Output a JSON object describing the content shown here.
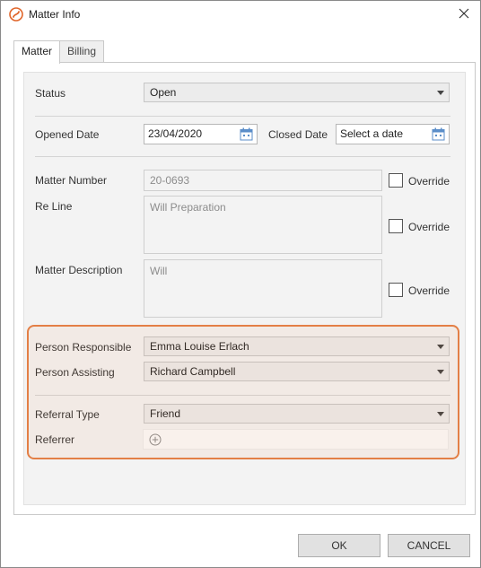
{
  "window": {
    "title": "Matter Info",
    "app_icon": "app-logo-icon",
    "close_icon": "close-icon"
  },
  "tabs": [
    {
      "label": "Matter",
      "active": true
    },
    {
      "label": "Billing",
      "active": false
    }
  ],
  "form": {
    "status": {
      "label": "Status",
      "value": "Open"
    },
    "opened_date": {
      "label": "Opened Date",
      "value": "23/04/2020"
    },
    "closed_date": {
      "label": "Closed Date",
      "placeholder": "Select a date"
    },
    "matter_number": {
      "label": "Matter Number",
      "value": "20-0693",
      "override_label": "Override"
    },
    "re_line": {
      "label": "Re Line",
      "value": "Will Preparation",
      "override_label": "Override"
    },
    "matter_description": {
      "label": "Matter Description",
      "value": "Will",
      "override_label": "Override"
    },
    "person_responsible": {
      "label": "Person Responsible",
      "value": "Emma Louise Erlach"
    },
    "person_assisting": {
      "label": "Person Assisting",
      "value": "Richard Campbell"
    },
    "referral_type": {
      "label": "Referral Type",
      "value": "Friend"
    },
    "referrer": {
      "label": "Referrer",
      "add_icon": "plus-circle-icon"
    }
  },
  "buttons": {
    "ok": "OK",
    "cancel": "CANCEL"
  },
  "colors": {
    "highlight": "#e37f46",
    "app_icon": "#e0652a"
  }
}
